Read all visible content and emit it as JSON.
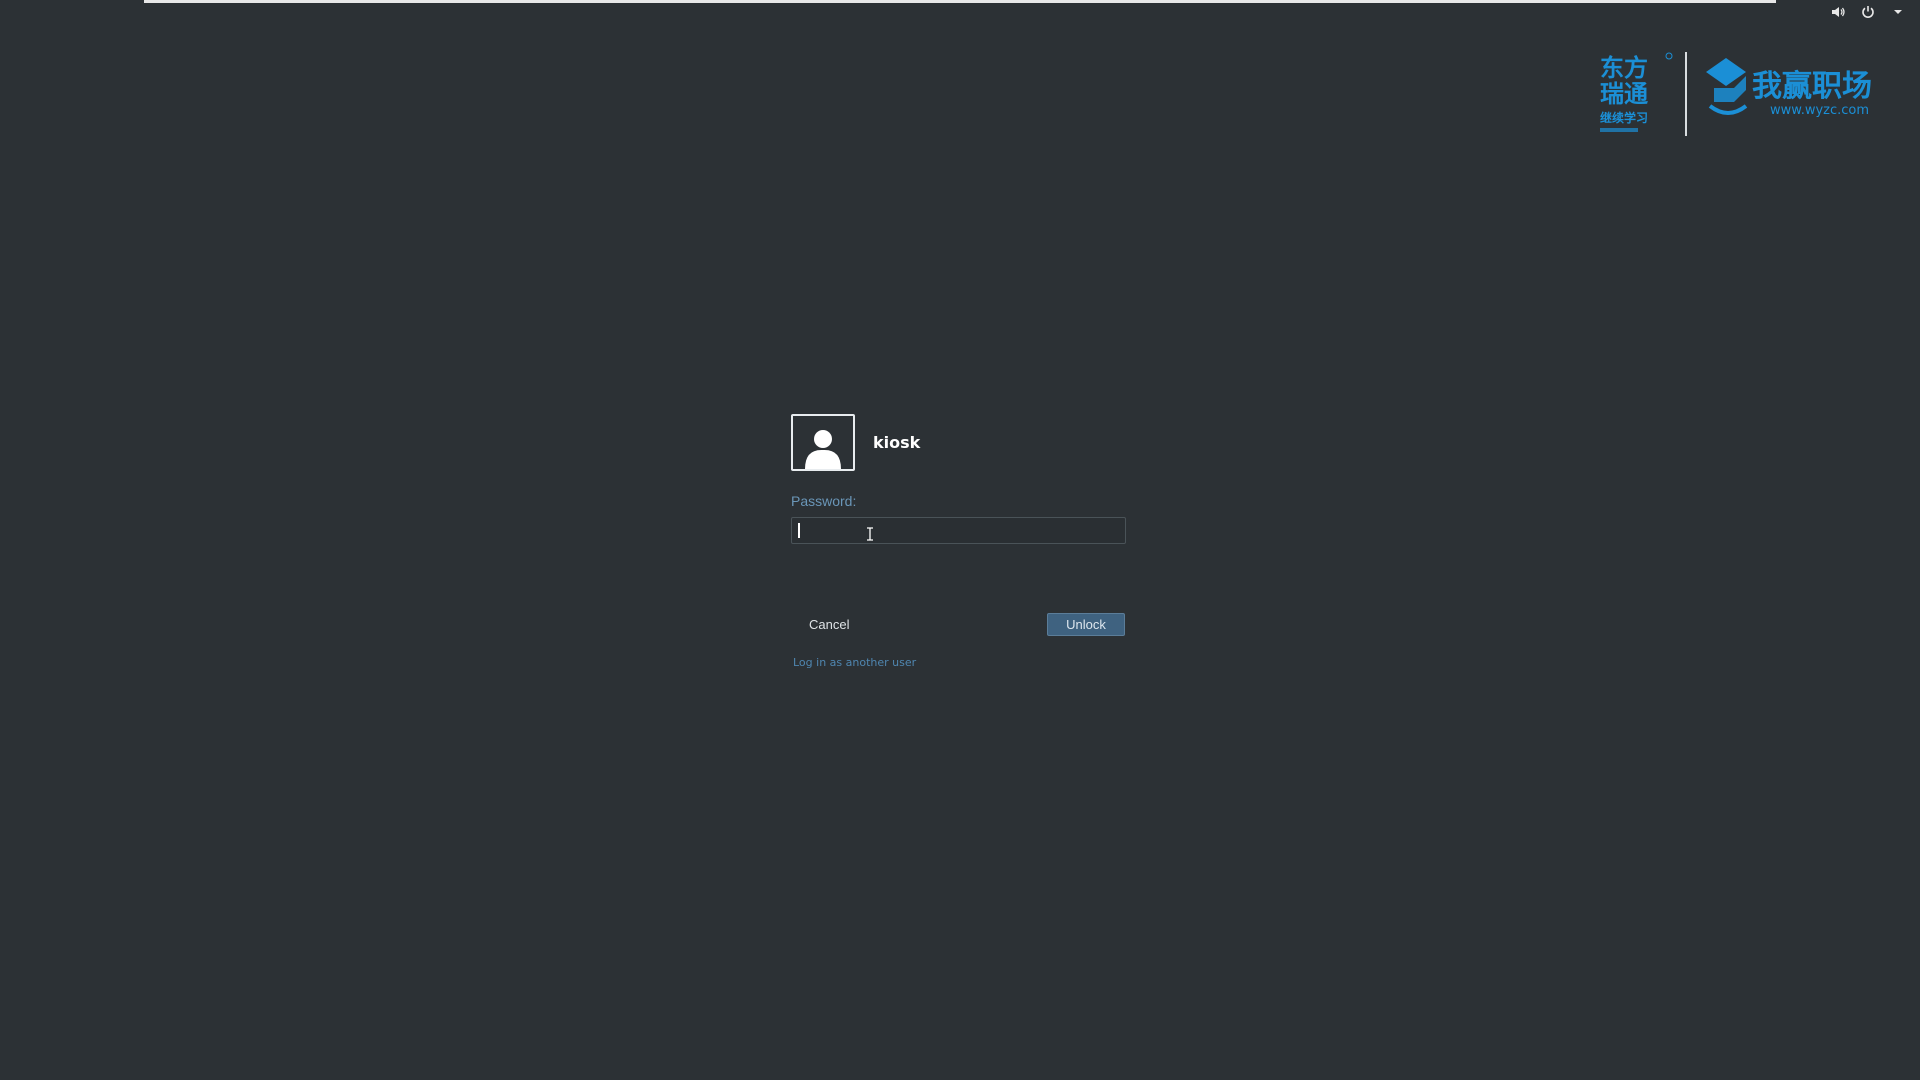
{
  "top_bar": {
    "icons": [
      "volume-icon",
      "power-icon",
      "dropdown-arrow-icon"
    ]
  },
  "branding": {
    "left_logo": "东方瑞通 继续学习",
    "right_logo": "我赢职场",
    "right_logo_url": "www.wyzc.com",
    "accent_color": "#1b8fd6"
  },
  "login": {
    "username": "kiosk",
    "password_label": "Password:",
    "password_value": "",
    "cancel_label": "Cancel",
    "unlock_label": "Unlock",
    "other_user_label": "Log in as another user"
  },
  "colors": {
    "background": "#2c3135",
    "label_blue": "#6a96b8",
    "button_blue": "#3f6280",
    "link_blue": "#4f86b0"
  }
}
